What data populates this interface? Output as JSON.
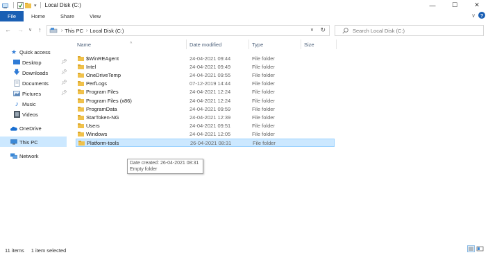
{
  "window": {
    "title": "Local Disk (C:)",
    "minimize": "—",
    "maximize": "☐",
    "close": "✕"
  },
  "ribbon": {
    "tabs": [
      "File",
      "Home",
      "Share",
      "View"
    ]
  },
  "address": {
    "crumbs": [
      "This PC",
      "Local Disk (C:)"
    ],
    "search_placeholder": "Search Local Disk (C:)"
  },
  "navpane": {
    "quick_access": "Quick access",
    "pinned": [
      "Desktop",
      "Downloads",
      "Documents",
      "Pictures"
    ],
    "others": [
      "Music",
      "Videos"
    ],
    "onedrive": "OneDrive",
    "this_pc": "This PC",
    "network": "Network"
  },
  "columns": {
    "name": "Name",
    "date": "Date modified",
    "type": "Type",
    "size": "Size"
  },
  "files": [
    {
      "name": "$WinREAgent",
      "date": "24-04-2021 09:44",
      "type": "File folder"
    },
    {
      "name": "Intel",
      "date": "24-04-2021 09:49",
      "type": "File folder"
    },
    {
      "name": "OneDriveTemp",
      "date": "24-04-2021 09:55",
      "type": "File folder"
    },
    {
      "name": "PerfLogs",
      "date": "07-12-2019 14:44",
      "type": "File folder"
    },
    {
      "name": "Program Files",
      "date": "24-04-2021 12:24",
      "type": "File folder"
    },
    {
      "name": "Program Files (x86)",
      "date": "24-04-2021 12:24",
      "type": "File folder"
    },
    {
      "name": "ProgramData",
      "date": "24-04-2021 09:59",
      "type": "File folder"
    },
    {
      "name": "StarToken-NG",
      "date": "24-04-2021 12:39",
      "type": "File folder"
    },
    {
      "name": "Users",
      "date": "24-04-2021 09:51",
      "type": "File folder"
    },
    {
      "name": "Windows",
      "date": "24-04-2021 12:05",
      "type": "File folder"
    },
    {
      "name": "Platform-tools",
      "date": "26-04-2021 08:31",
      "type": "File folder"
    }
  ],
  "tooltip": {
    "line1": "Date created: 26-04-2021 08:31",
    "line2": "Empty folder"
  },
  "status": {
    "count": "11 items",
    "selected": "1 item selected"
  },
  "colors": {
    "accent": "#1a5fb4",
    "selection": "#cce8ff",
    "folder": "#f0c14b"
  }
}
